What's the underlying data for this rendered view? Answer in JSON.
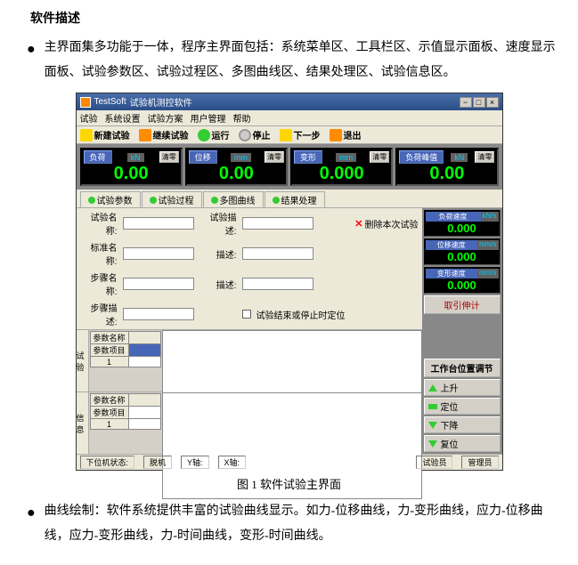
{
  "doc": {
    "heading": "软件描述",
    "bullet1": "主界面集多功能于一体，程序主界面包括：系统菜单区、工具栏区、示值显示面板、速度显示面板、试验参数区、试验过程区、多图曲线区、结果处理区、试验信息区。",
    "caption": "图 1 软件试验主界面",
    "bullet2": "曲线绘制：软件系统提供丰富的试验曲线显示。如力-位移曲线，力-变形曲线，应力-位移曲线，应力-变形曲线，力-时间曲线，变形-时间曲线。"
  },
  "win": {
    "title_icon": "TestSoft",
    "title": "试验机测控软件",
    "menu": [
      "试验",
      "系统设置",
      "试验方案",
      "用户管理",
      "帮助"
    ],
    "toolbar": {
      "new": "新建试验",
      "cont": "继续试验",
      "run": "运行",
      "stop": "停止",
      "next": "下一步",
      "exit": "退出"
    },
    "readings": [
      {
        "label": "负荷",
        "unit": "kN",
        "clear": "清零",
        "value": "0.00"
      },
      {
        "label": "位移",
        "unit": "mm",
        "clear": "清零",
        "value": "0.00"
      },
      {
        "label": "变形",
        "unit": "mm",
        "clear": "清零",
        "value": "0.000"
      },
      {
        "label": "负荷峰值",
        "unit": "kN",
        "clear": "清零",
        "value": "0.00"
      }
    ],
    "tabs": [
      "试验参数",
      "试验过程",
      "多图曲线",
      "结果处理"
    ],
    "params": {
      "l1": "试验名称:",
      "l2": "标准名称:",
      "l3": "步骤名称:",
      "l4": "步骤描述:",
      "r1": "试验描述:",
      "r2": "描述:",
      "del": "删除本次试验",
      "cb_label": "试验结束或停止时定位",
      "col1": "参数名称",
      "col2": "参数项目",
      "row1": "1",
      "side_top": "试验",
      "side_bot": "信息"
    },
    "speeds": [
      {
        "label": "负荷速度",
        "unit": "kN/s",
        "value": "0.000"
      },
      {
        "label": "位移速度",
        "unit": "mm/s",
        "value": "0.000"
      },
      {
        "label": "变形速度",
        "unit": "mm/s",
        "value": "0.000"
      }
    ],
    "ext": "取引伸计",
    "pos_title": "工作台位置调节",
    "pos": {
      "up": "上升",
      "mid": "定位",
      "down": "下降",
      "back": "复位"
    },
    "status": {
      "s1": "下位机状态:",
      "s2": "脱机",
      "s3": "Y轴:",
      "s4": "X轴:",
      "s5": "试验员",
      "s6": "管理员"
    }
  }
}
